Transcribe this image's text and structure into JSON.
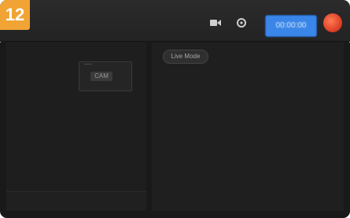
{
  "step_badge": "12",
  "toolbar": {
    "camera_icon": "camera-icon",
    "settings_icon": "gear-icon",
    "meter_label": "00:00:00",
    "record_icon": "record-icon"
  },
  "main": {
    "pill_label": "Live Mode",
    "panel_chip_label": "CAM"
  },
  "colors": {
    "badge": "#f1a434",
    "meter": "#3a86e8",
    "record": "#e0432a",
    "meter_green": "#3fae4a"
  }
}
